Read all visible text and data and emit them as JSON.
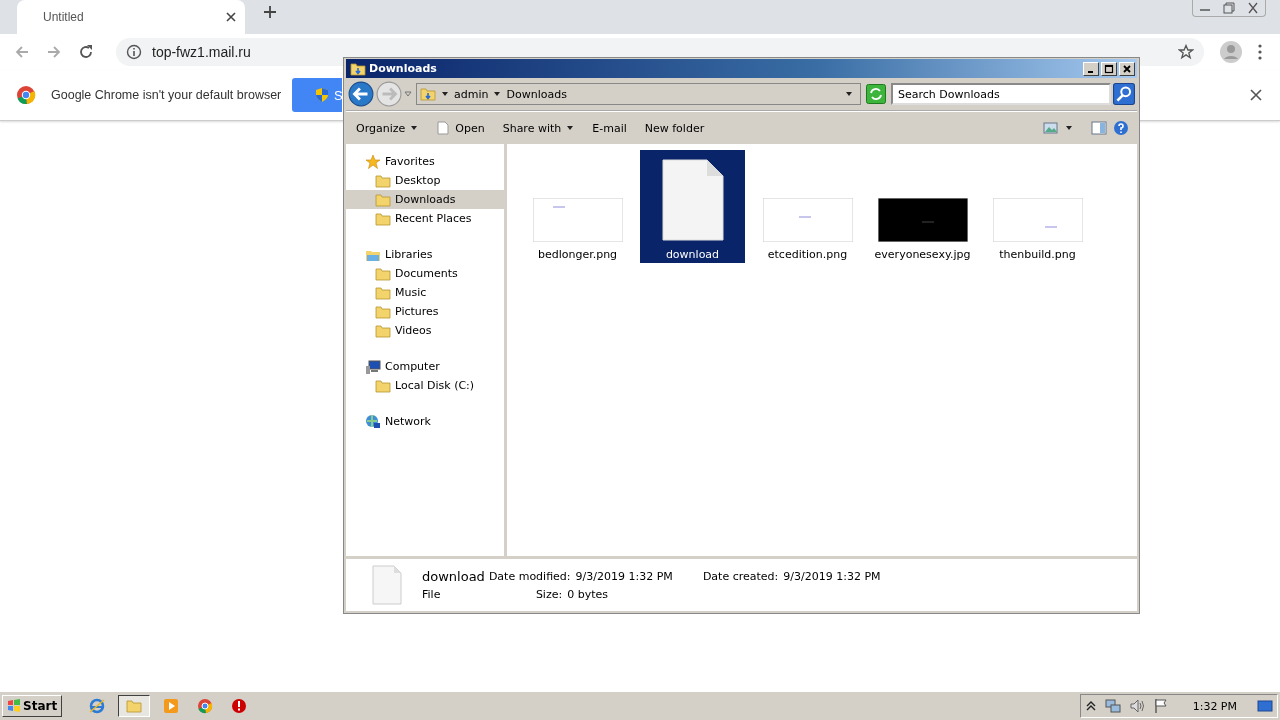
{
  "browser": {
    "tab": {
      "title": "Untitled"
    },
    "address": "top-fwz1.mail.ru",
    "infobar": {
      "message": "Google Chrome isn't your default browser",
      "button": "S"
    }
  },
  "explorer": {
    "title": "Downloads",
    "breadcrumb": [
      "admin",
      "Downloads"
    ],
    "search": {
      "placeholder": "Search Downloads"
    },
    "commands": [
      {
        "label": "Organize",
        "dropdown": true
      },
      {
        "label": "Open",
        "dropdown": false
      },
      {
        "label": "Share with",
        "dropdown": true
      },
      {
        "label": "E-mail",
        "dropdown": false
      },
      {
        "label": "New folder",
        "dropdown": false
      }
    ],
    "nav": [
      {
        "label": "Favorites",
        "children": [
          {
            "label": "Desktop",
            "selected": false
          },
          {
            "label": "Downloads",
            "selected": true
          },
          {
            "label": "Recent Places",
            "selected": false
          }
        ]
      },
      {
        "label": "Libraries",
        "children": [
          {
            "label": "Documents",
            "selected": false
          },
          {
            "label": "Music",
            "selected": false
          },
          {
            "label": "Pictures",
            "selected": false
          },
          {
            "label": "Videos",
            "selected": false
          }
        ]
      },
      {
        "label": "Computer",
        "children": [
          {
            "label": "Local Disk (C:)",
            "selected": false
          }
        ]
      },
      {
        "label": "Network"
      }
    ],
    "files": [
      {
        "name": "bedlonger.png",
        "kind": "light",
        "selected": false
      },
      {
        "name": "download",
        "kind": "document",
        "selected": true
      },
      {
        "name": "etcedition.png",
        "kind": "light",
        "selected": false
      },
      {
        "name": "everyonesexy.jpg",
        "kind": "dark",
        "selected": false
      },
      {
        "name": "thenbuild.png",
        "kind": "light",
        "selected": false
      }
    ],
    "details": {
      "name": "download",
      "type": "File",
      "fields": [
        {
          "label": "Date modified:",
          "value": "9/3/2019 1:32 PM"
        },
        {
          "label": "Size:",
          "value": "0 bytes"
        },
        {
          "label": "Date created:",
          "value": "9/3/2019 1:32 PM"
        }
      ]
    }
  },
  "taskbar": {
    "start": "Start",
    "apps": [
      {
        "selected": false
      },
      {
        "selected": true
      },
      {
        "selected": false
      },
      {
        "selected": false
      },
      {
        "selected": false
      }
    ],
    "clock": "1:32 PM"
  }
}
